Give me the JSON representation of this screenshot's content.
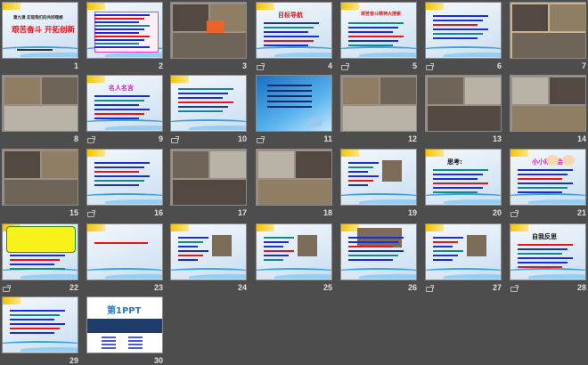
{
  "view": "Slide Sorter",
  "slides": [
    {
      "number": "1",
      "theme": "tpl",
      "subtitle": "第九课 实现我们的共同理想",
      "title": "艰苦奋斗 开拓创新",
      "animation": false
    },
    {
      "number": "2",
      "theme": "tpl",
      "title": "话题导入",
      "animation": false
    },
    {
      "number": "3",
      "theme": "photo",
      "animation": false
    },
    {
      "number": "4",
      "theme": "tpl",
      "title": "目标导航",
      "animation": true
    },
    {
      "number": "5",
      "theme": "tpl",
      "title": "艰苦奋斗精神大搜索",
      "animation": true
    },
    {
      "number": "6",
      "theme": "tpl",
      "animation": true
    },
    {
      "number": "7",
      "theme": "photo",
      "animation": false
    },
    {
      "number": "8",
      "theme": "photo",
      "animation": false
    },
    {
      "number": "9",
      "theme": "tpl",
      "title": "名人名言",
      "animation": true
    },
    {
      "number": "10",
      "theme": "tpl",
      "animation": true
    },
    {
      "number": "11",
      "theme": "blue",
      "animation": true
    },
    {
      "number": "12",
      "theme": "photo",
      "animation": false
    },
    {
      "number": "13",
      "theme": "photo",
      "animation": false
    },
    {
      "number": "14",
      "theme": "photo",
      "animation": false
    },
    {
      "number": "15",
      "theme": "photo",
      "animation": false
    },
    {
      "number": "16",
      "theme": "tpl",
      "animation": true
    },
    {
      "number": "17",
      "theme": "photo",
      "animation": false
    },
    {
      "number": "18",
      "theme": "photo",
      "animation": false
    },
    {
      "number": "19",
      "theme": "tpl",
      "animation": false
    },
    {
      "number": "20",
      "theme": "tpl",
      "title": "思考:",
      "animation": false
    },
    {
      "number": "21",
      "theme": "tpl",
      "title": "小小辩论会",
      "animation": true
    },
    {
      "number": "22",
      "theme": "tpl",
      "animation": true
    },
    {
      "number": "23",
      "theme": "tpl",
      "animation": false
    },
    {
      "number": "24",
      "theme": "tpl",
      "animation": false
    },
    {
      "number": "25",
      "theme": "tpl",
      "animation": false
    },
    {
      "number": "26",
      "theme": "tpl",
      "animation": false
    },
    {
      "number": "27",
      "theme": "tpl",
      "animation": true
    },
    {
      "number": "28",
      "theme": "tpl",
      "title": "自我反思",
      "animation": true
    },
    {
      "number": "29",
      "theme": "tpl",
      "animation": false
    },
    {
      "number": "30",
      "theme": "white",
      "title": "第1PPT",
      "animation": false
    }
  ],
  "colors": {
    "background": "#4d4d4d",
    "accent_red": "#e8141c",
    "text_blue": "#1a2fd0"
  }
}
